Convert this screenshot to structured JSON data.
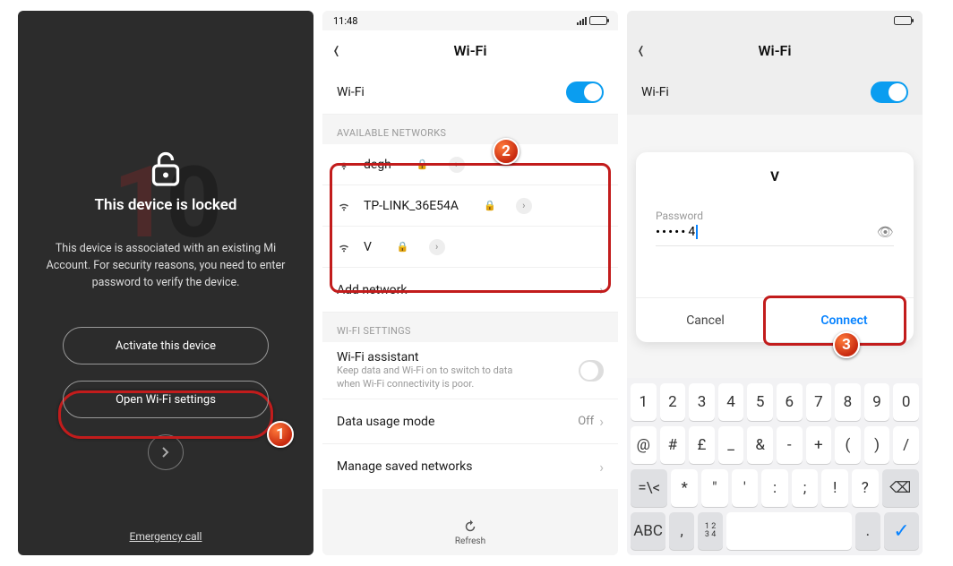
{
  "screen1": {
    "bg_text_a": "1",
    "bg_text_b": "0",
    "title": "This device is locked",
    "description": "This device is associated with an existing Mi Account. For security reasons, you need to enter password to verify the device.",
    "activate_btn": "Activate this device",
    "wifi_btn": "Open Wi-Fi settings",
    "emergency": "Emergency call"
  },
  "screen2": {
    "time": "11:48",
    "title": "Wi-Fi",
    "wifi_label": "Wi-Fi",
    "available_header": "AVAILABLE NETWORKS",
    "networks": [
      {
        "name": "degh"
      },
      {
        "name": "TP-LINK_36E54A"
      },
      {
        "name": "V"
      }
    ],
    "add_network": "Add network",
    "settings_header": "WI-FI SETTINGS",
    "assistant_title": "Wi-Fi assistant",
    "assistant_sub": "Keep data and Wi-Fi on to switch to data when Wi-Fi connectivity is poor.",
    "data_mode": "Data usage mode",
    "data_mode_value": "Off",
    "manage": "Manage saved networks",
    "refresh": "Refresh"
  },
  "screen3": {
    "title": "Wi-Fi",
    "wifi_label": "Wi-Fi",
    "dialog_title": "V",
    "password_label": "Password",
    "password_mask": "•••••",
    "password_plain": "4",
    "cancel": "Cancel",
    "connect": "Connect",
    "kb_r1": [
      "1",
      "2",
      "3",
      "4",
      "5",
      "6",
      "7",
      "8",
      "9",
      "0"
    ],
    "kb_r2": [
      "@",
      "#",
      "£",
      "_",
      "&",
      "-",
      "+",
      "(",
      ")",
      "/"
    ],
    "kb_r3_lead": "=\\<",
    "kb_r3": [
      "*",
      "\"",
      "'",
      ":",
      ";",
      "!",
      "?"
    ],
    "kb_r3_del": "⌫",
    "kb_abc": "ABC",
    "kb_comma": ",",
    "kb_frac_top": "1 2",
    "kb_frac_bot": "3 4",
    "kb_dot": ".",
    "kb_ok": "✓"
  },
  "badges": {
    "b1": "1",
    "b2": "2",
    "b3": "3"
  }
}
